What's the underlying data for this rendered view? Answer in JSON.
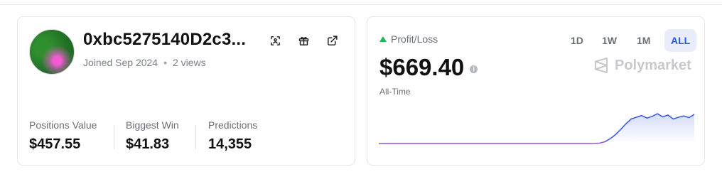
{
  "profile": {
    "username": "0xbc5275140D2c3...",
    "joined": "Joined Sep 2024",
    "views": "2 views",
    "stats": [
      {
        "label": "Positions Value",
        "value": "$457.55"
      },
      {
        "label": "Biggest Win",
        "value": "$41.83"
      },
      {
        "label": "Predictions",
        "value": "14,355"
      }
    ],
    "icons": [
      "scan-icon",
      "gift-icon",
      "external-link-icon"
    ]
  },
  "pnl": {
    "label": "Profit/Loss",
    "value": "$669.40",
    "period_label": "All-Time",
    "timeframes": [
      "1D",
      "1W",
      "1M",
      "ALL"
    ],
    "active_timeframe": "ALL",
    "brand": "Polymarket",
    "colors": {
      "up": "#1db954",
      "line_flat": "#8c52e0",
      "line_active": "#3f5fdc",
      "active_tab_bg": "#e8ecfb",
      "active_tab_text": "#2f5bd6"
    }
  },
  "chart_data": {
    "type": "area",
    "title": "",
    "xlabel": "",
    "ylabel": "",
    "x": [
      0,
      1,
      2,
      3,
      4,
      5,
      6,
      7,
      8,
      9,
      10,
      11,
      12,
      13,
      14,
      15,
      16,
      17,
      18,
      19,
      20,
      21,
      22,
      23,
      24,
      25,
      26,
      27,
      28,
      29,
      30,
      31,
      32,
      33,
      34,
      35,
      36,
      37,
      38,
      39,
      40,
      41,
      42,
      43,
      44,
      45,
      46,
      47,
      48,
      49,
      50,
      51,
      52,
      53,
      54,
      55,
      56,
      57,
      58,
      59,
      60
    ],
    "series": [
      {
        "values": [
          0,
          0,
          0,
          0,
          0,
          0,
          0,
          0,
          0,
          0,
          0,
          0,
          0,
          0,
          0,
          0,
          0,
          0,
          0,
          0,
          0,
          0,
          0,
          0,
          0,
          0,
          0,
          0,
          0,
          0,
          0,
          0,
          0,
          0,
          0,
          0,
          0,
          0,
          0,
          0,
          0,
          2,
          8,
          40,
          110,
          200,
          320,
          450,
          560,
          600,
          640,
          580,
          620,
          680,
          610,
          650,
          560,
          600,
          630,
          590,
          669.4
        ]
      }
    ]
  }
}
